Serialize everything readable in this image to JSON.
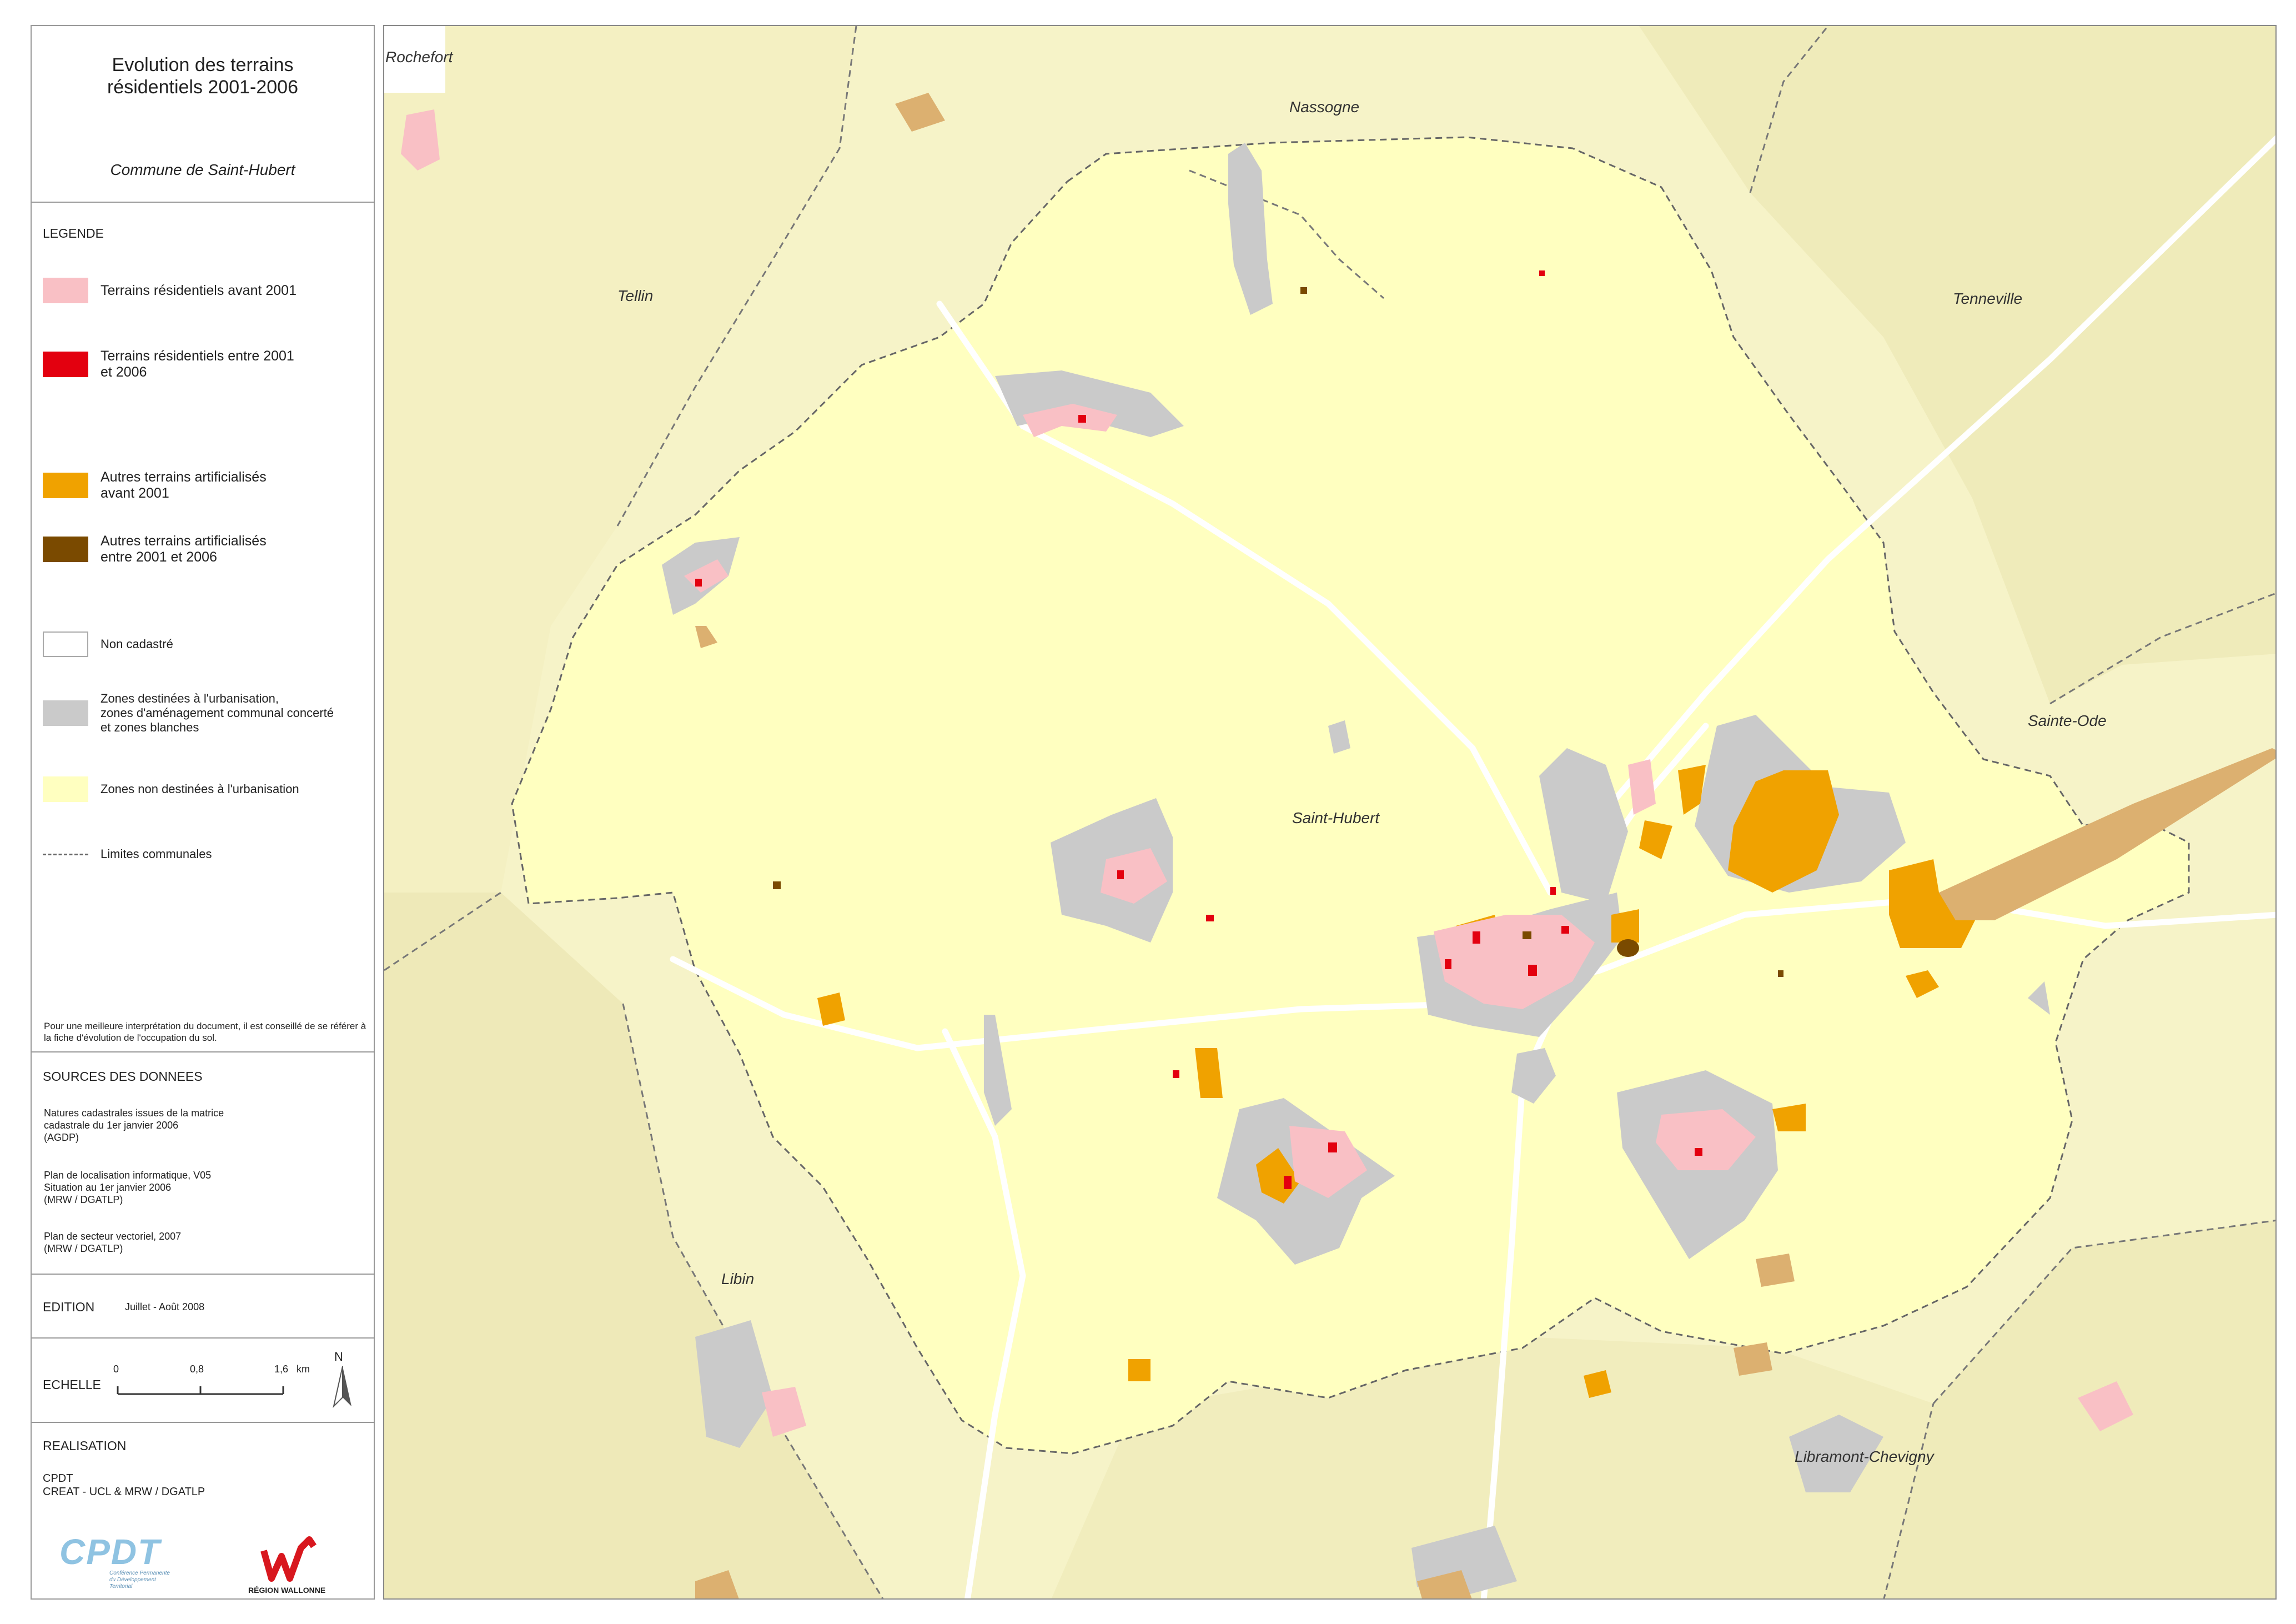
{
  "title": {
    "main": "Evolution des terrains\nrésidentiels 2001-2006",
    "commune": "Commune de Saint-Hubert"
  },
  "legend": {
    "heading": "LEGENDE",
    "items": [
      {
        "label": "Terrains résidentiels avant 2001",
        "color": "#f9c0c5"
      },
      {
        "label": "Terrains résidentiels entre 2001\net 2006",
        "color": "#e3000f"
      },
      {
        "label": "Autres terrains artificialisés\navant 2001",
        "color": "#f0a200"
      },
      {
        "label": "Autres terrains artificialisés\nentre 2001 et 2006",
        "color": "#7a4a00"
      },
      {
        "label": "Non cadastré",
        "color": "#ffffff"
      },
      {
        "label": "Zones destinées à l'urbanisation,\nzones d'aménagement communal concerté\net zones blanches",
        "color": "#cacaca"
      },
      {
        "label": "Zones non destinées à l'urbanisation",
        "color": "#ffffc0"
      },
      {
        "label": "Limites communales",
        "color": "#666666"
      }
    ],
    "note": "Pour une meilleure interprétation du document, il est conseillé de se référer à la fiche d'évolution de l'occupation du sol."
  },
  "sources": {
    "heading": "SOURCES DES DONNEES",
    "items": [
      "Natures cadastrales issues de la matrice\ncadastrale du 1er janvier 2006\n(AGDP)",
      "Plan de localisation informatique, V05\nSituation au 1er janvier 2006\n(MRW / DGATLP)",
      "Plan de secteur vectoriel, 2007\n(MRW / DGATLP)"
    ]
  },
  "edition": {
    "label": "EDITION",
    "value": "Juillet - Août 2008"
  },
  "scale": {
    "label": "ECHELLE",
    "ticks": [
      "0",
      "0,8",
      "1,6"
    ],
    "unit": "km",
    "north": "N"
  },
  "realisation": {
    "heading": "REALISATION",
    "lines": "CPDT\nCREAT - UCL & MRW / DGATLP",
    "logo_cpdt": "CPDT",
    "logo_cpdt_sub": "Conférence Permanente\ndu Développement\nTerritorial",
    "logo_region": "RÉGION WALLONNE"
  },
  "map": {
    "colors": {
      "outside": "#f6f3c8",
      "commune": "#ffffc0",
      "urban": "#cacaca",
      "resid_old": "#f9c0c5",
      "resid_new": "#e3000f",
      "artif_old": "#f0a200",
      "artif_new": "#7a4a00",
      "artif_outside": "#dcb070",
      "road": "#ffffff",
      "boundary": "#666666"
    },
    "places": [
      "Rochefort",
      "Nassogne",
      "Tellin",
      "Tenneville",
      "Sainte-Ode",
      "Saint-Hubert",
      "Libin",
      "Libramont-Chevigny"
    ]
  }
}
